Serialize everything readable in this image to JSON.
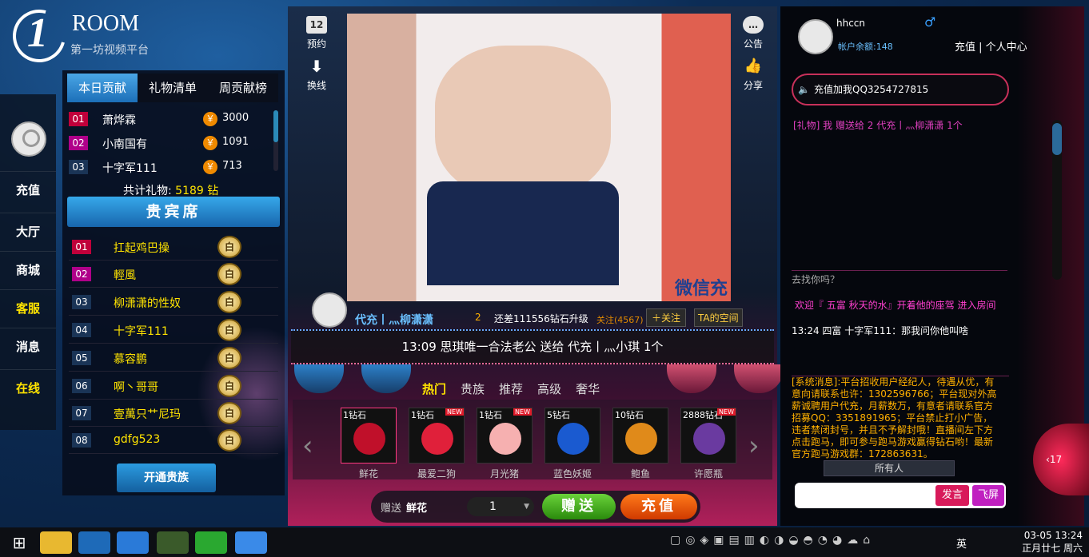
{
  "logo": {
    "brand": "ROOM",
    "numeral": "1",
    "subtitle": "第一坊视频平台"
  },
  "leftnav": [
    "充值",
    "大厅",
    "商城",
    "客服",
    "消息",
    "在线"
  ],
  "rank": {
    "tabs": [
      "本日贡献",
      "礼物清单",
      "周贡献榜"
    ],
    "rows": [
      {
        "no": "01",
        "name": "萧烨霖",
        "val": "3000"
      },
      {
        "no": "02",
        "name": "小南国有",
        "val": "1091"
      },
      {
        "no": "03",
        "name": "十字军111",
        "val": "713"
      }
    ],
    "total_label": "共计礼物:",
    "total": "5189",
    "unit": "钻",
    "coin": "￥"
  },
  "vip": {
    "title": "贵宾席",
    "rows": [
      {
        "no": "01",
        "name": "扛起鸡巴操"
      },
      {
        "no": "02",
        "name": "輕風"
      },
      {
        "no": "03",
        "name": "柳潇潇的性奴"
      },
      {
        "no": "04",
        "name": "十字军111"
      },
      {
        "no": "05",
        "name": "慕容鹏"
      },
      {
        "no": "06",
        "name": "啊丶哥哥"
      },
      {
        "no": "07",
        "name": "壹萬只艹尼玛"
      },
      {
        "no": "08",
        "name": "gdfg523"
      }
    ],
    "badge": "白",
    "open_btn": "开通贵族"
  },
  "video": {
    "watermark": "微信充"
  },
  "side": {
    "book": "预约",
    "switch": "换线",
    "notice": "公告",
    "share": "分享",
    "cal": "12"
  },
  "host": {
    "name": "代充丨灬柳潇潇",
    "level": "2",
    "upgrade": "还差111556钻石升级",
    "fans": "关注(4567)",
    "follow": "＋关注",
    "space": "TA的空间"
  },
  "marquee": "13:09  思琪唯一合法老公 送给 代充丨灬小琪    1个",
  "gift_tabs": [
    "热门",
    "贵族",
    "推荐",
    "高级",
    "奢华"
  ],
  "gifts": [
    {
      "price": "1钻石",
      "name": "鲜花",
      "new": "",
      "color": "#c0102a"
    },
    {
      "price": "1钻石",
      "name": "最爱二狗",
      "new": "NEW",
      "color": "#e0203a"
    },
    {
      "price": "1钻石",
      "name": "月光猪",
      "new": "NEW",
      "color": "#f6b0b0"
    },
    {
      "price": "5钻石",
      "name": "蓝色妖姬",
      "new": "",
      "color": "#1a5ad0"
    },
    {
      "price": "10钻石",
      "name": "鲍鱼",
      "new": "",
      "color": "#e08a1a"
    },
    {
      "price": "2888钻石",
      "name": "许愿瓶",
      "new": "NEW",
      "color": "#6a3aa0"
    }
  ],
  "send": {
    "label": "赠送",
    "gift": "鲜花",
    "qty": "1",
    "send_btn": "赠送",
    "recharge_btn": "充值"
  },
  "user": {
    "name": "hhccn",
    "male": "♂",
    "balance": "帐户余额:148",
    "links": "充值 | 个人中心"
  },
  "notice": "充值加我QQ3254727815",
  "giftmsg": "[礼物] 我 赠送给 2 代充丨灬柳潇潇 1个",
  "chat": [
    {
      "text": "去找你吗？",
      "color": "#aaa"
    },
    {
      "text": "欢迎『 五富 秋天的水』开着他的座驾  进入房间",
      "color": "#ff40d0"
    },
    {
      "text": "13:24  四富 十字军111：那我问你他叫啥",
      "color": "#fff"
    }
  ],
  "system": "[系统消息]:平台招收用户经纪人，待遇从优，有意向请联系也许：1302596766；平台现对外高薪诚聘用户代充，月薪数万，有意者请联系官方招募QQ：3351891965；平台禁止打小广告，违者禁闭封号，并且不予解封哦！直播间左下方点击跑马，即可参与跑马游戏赢得钻石哟！最新官方跑马游戏群：172863631。",
  "chat_target": "所有人",
  "speak_btn": "发言",
  "fly_btn": "飞屏",
  "side_count": "17",
  "clock": {
    "time": "03-05 13:24",
    "date": "正月廿七 周六"
  },
  "ime": "英"
}
